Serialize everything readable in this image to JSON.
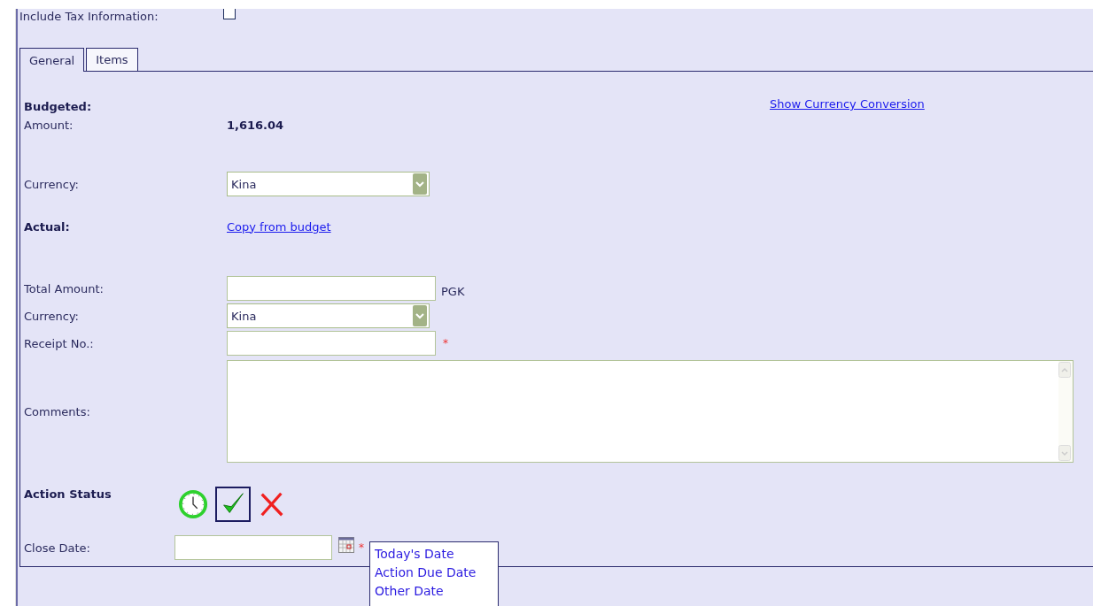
{
  "include_tax": {
    "label": "Include Tax Information:",
    "checked": false
  },
  "tabs": [
    {
      "label": "General",
      "selected": true
    },
    {
      "label": "Items",
      "selected": false
    }
  ],
  "budgeted": {
    "heading": "Budgeted:",
    "amount_label": "Amount:",
    "amount": "1,616.04",
    "conversion_link": "Show Currency Conversion",
    "currency_label": "Currency:",
    "currency": "Kina"
  },
  "actual": {
    "heading": "Actual:",
    "copy_link": "Copy from budget",
    "total_label": "Total Amount:",
    "total_unit": "PGK",
    "currency_label": "Currency:",
    "currency": "Kina",
    "receipt_label": "Receipt No.:",
    "required_mark": "*",
    "comments_label": "Comments:"
  },
  "action_status": {
    "label": "Action Status",
    "options": [
      {
        "kind": "pending",
        "selected": false
      },
      {
        "kind": "done",
        "selected": true
      },
      {
        "kind": "cancelled",
        "selected": false
      }
    ]
  },
  "close_date": {
    "label": "Close Date:",
    "required_mark": "*",
    "menu": [
      "Today's Date",
      "Action Due Date",
      "Other Date"
    ]
  }
}
